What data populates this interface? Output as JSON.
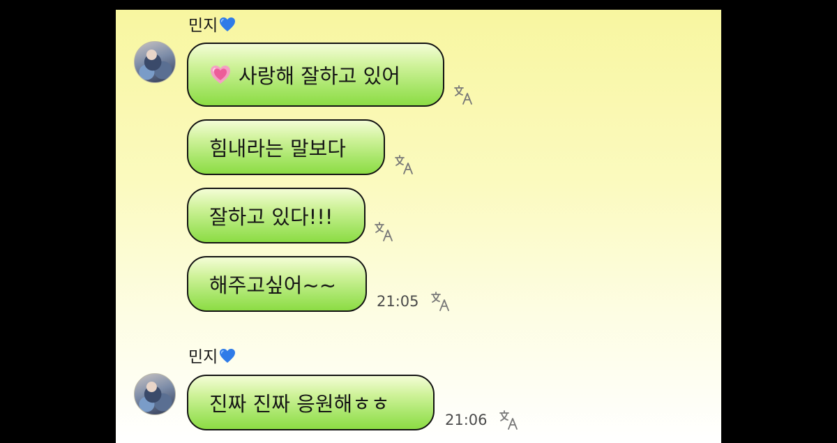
{
  "chat": {
    "groups": [
      {
        "sender": "민지",
        "messages": [
          {
            "text": "사랑해 잘하고 있어",
            "emoji": "growing-heart-emoji"
          },
          {
            "text": "힘내라는 말보다"
          },
          {
            "text": "잘하고 있다!!!"
          },
          {
            "text": "해주고싶어~~",
            "time": "21:05"
          }
        ]
      },
      {
        "sender": "민지",
        "messages": [
          {
            "text": "진짜 진짜 응원해ㅎㅎ",
            "time": "21:06"
          }
        ]
      }
    ]
  },
  "icons": {
    "sender_heart": "blue-heart-icon",
    "translate": "translate-icon",
    "avatar": "profile-photo"
  },
  "colors": {
    "background_top": "#f8f6a0",
    "background_bottom": "#ffffff",
    "bubble_top": "#f4fdd6",
    "bubble_bottom": "#8cdc44",
    "heart_blue": "#2f7be8",
    "emoji_pink": "#f06aa5"
  }
}
